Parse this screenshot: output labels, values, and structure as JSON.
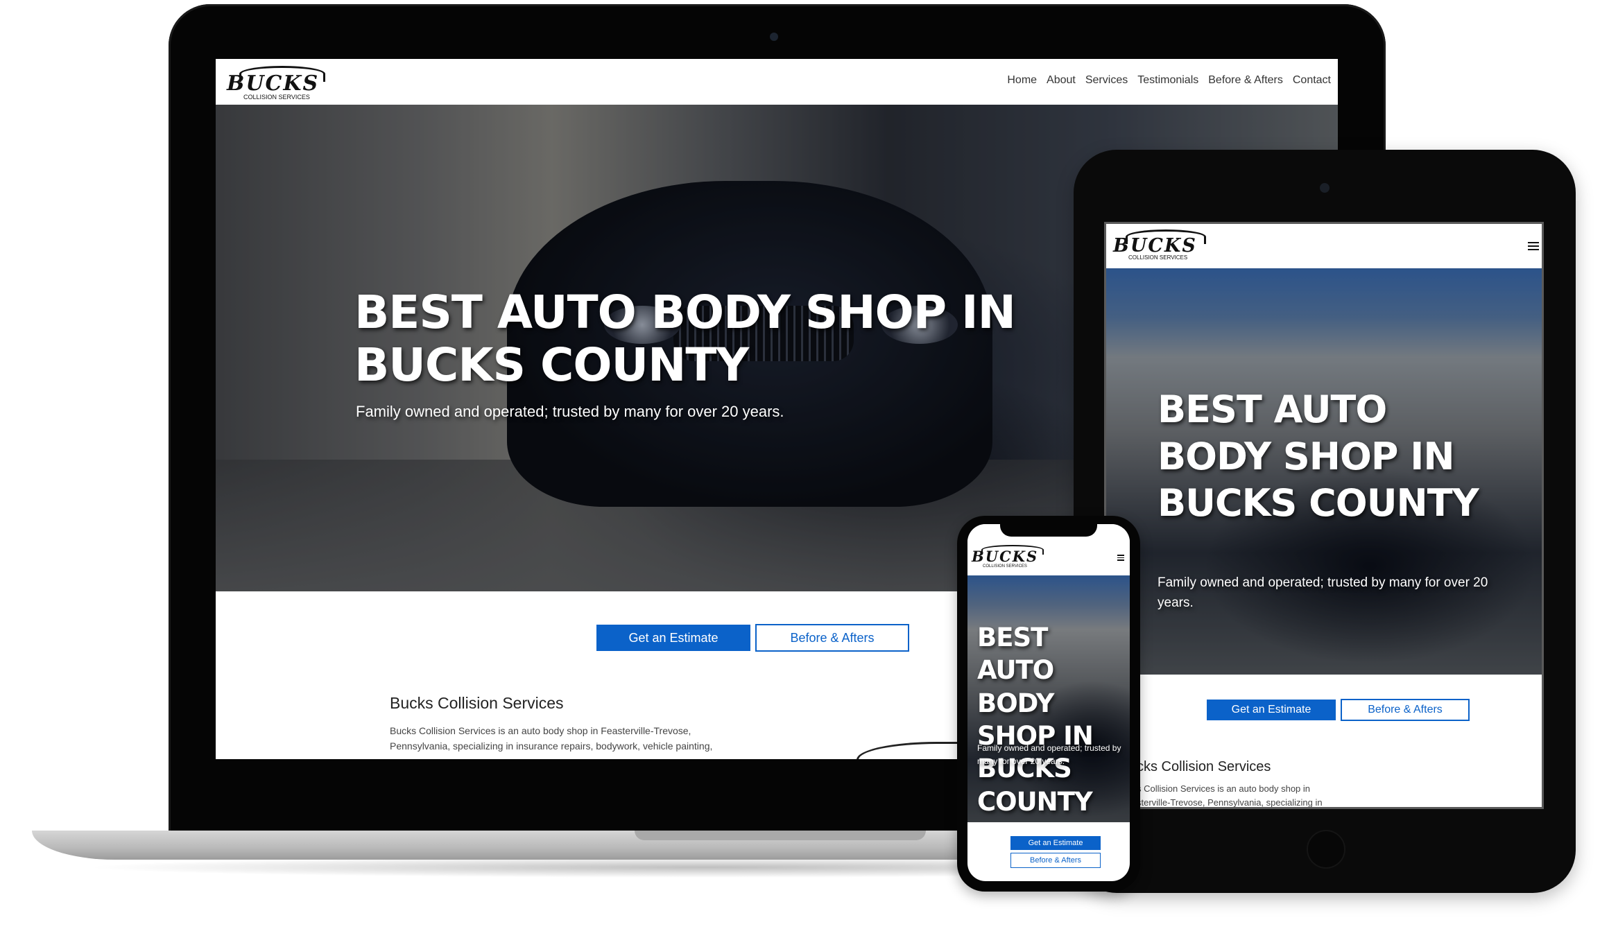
{
  "brand": {
    "name": "BUCKS",
    "tagline": "COLLISION SERVICES"
  },
  "nav": {
    "items": [
      "Home",
      "About",
      "Services",
      "Testimonials",
      "Before & Afters",
      "Contact"
    ]
  },
  "hero": {
    "title": "BEST AUTO BODY SHOP IN BUCKS COUNTY",
    "subtitle": "Family owned and operated; trusted by many for over 20 years."
  },
  "cta": {
    "estimate": "Get an Estimate",
    "before_afters": "Before & Afters"
  },
  "about": {
    "title": "Bucks Collision Services",
    "body_laptop": "Bucks Collision Services is an auto body shop in Feasterville-Trevose, Pennsylvania, specializing in insurance repairs, bodywork, vehicle painting,",
    "tablet_title": "cks Collision Services",
    "tablet_body_1": "s Collision Services is an auto body shop in",
    "tablet_body_2": "sterville-Trevose, Pennsylvania, specializing in"
  },
  "icons": {
    "menu": "hamburger-icon",
    "camera": "camera-dot-icon",
    "home": "home-button-icon"
  },
  "colors": {
    "accent": "#0b62c9",
    "device": "#050505",
    "base": "#bdbdbd"
  }
}
